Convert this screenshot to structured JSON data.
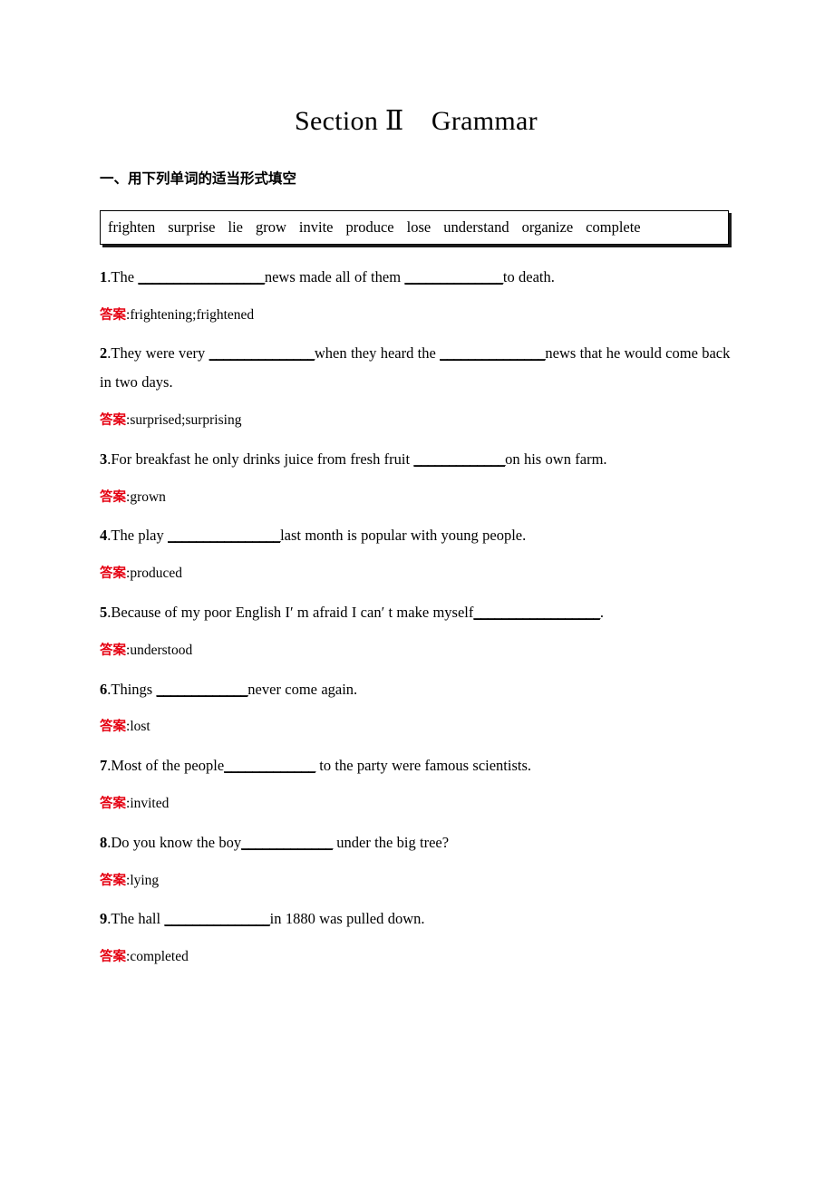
{
  "document": {
    "title": "Section Ⅱ　Grammar",
    "section_heading": "一、用下列单词的适当形式填空",
    "answer_label": "答案",
    "answer_separator": ":",
    "accent_color_answer_label": "#e50112",
    "text_color": "#000000",
    "background_color": "#ffffff"
  },
  "word_bank": {
    "words": [
      "frighten",
      "surprise",
      "lie",
      "grow",
      "invite",
      "produce",
      "lose",
      "understand",
      "organize",
      "complete"
    ]
  },
  "questions": [
    {
      "number": "1",
      "parts": [
        {
          "type": "text",
          "value": ".The "
        },
        {
          "type": "blank",
          "value": "__________________"
        },
        {
          "type": "text",
          "value": "news made all of them "
        },
        {
          "type": "blank",
          "value": "______________"
        },
        {
          "type": "text",
          "value": "to death."
        }
      ],
      "answer": "frightening;frightened"
    },
    {
      "number": "2",
      "parts": [
        {
          "type": "text",
          "value": ".They were very "
        },
        {
          "type": "blank",
          "value": "_______________"
        },
        {
          "type": "text",
          "value": "when they heard the "
        },
        {
          "type": "blank",
          "value": "_______________"
        },
        {
          "type": "text",
          "value": "news that he would come back in two days."
        }
      ],
      "answer": "surprised;surprising"
    },
    {
      "number": "3",
      "parts": [
        {
          "type": "text",
          "value": ".For breakfast he only drinks juice from fresh fruit "
        },
        {
          "type": "blank",
          "value": "_____________"
        },
        {
          "type": "text",
          "value": "on his own farm."
        }
      ],
      "answer": "grown"
    },
    {
      "number": "4",
      "parts": [
        {
          "type": "text",
          "value": ".The play "
        },
        {
          "type": "blank",
          "value": "________________"
        },
        {
          "type": "text",
          "value": "last month is popular with young people."
        }
      ],
      "answer": "produced"
    },
    {
      "number": "5",
      "parts": [
        {
          "type": "text",
          "value": ".Because of my poor English I′ m afraid I can′ t make myself"
        },
        {
          "type": "blank",
          "value": "__________________"
        },
        {
          "type": "text",
          "value": "."
        }
      ],
      "answer": "understood"
    },
    {
      "number": "6",
      "parts": [
        {
          "type": "text",
          "value": ".Things "
        },
        {
          "type": "blank",
          "value": "_____________"
        },
        {
          "type": "text",
          "value": "never come again."
        }
      ],
      "answer": "lost"
    },
    {
      "number": "7",
      "parts": [
        {
          "type": "text",
          "value": ".Most of the people"
        },
        {
          "type": "blank",
          "value": "_____________"
        },
        {
          "type": "text",
          "value": " to the party were famous scientists."
        }
      ],
      "answer": "invited"
    },
    {
      "number": "8",
      "parts": [
        {
          "type": "text",
          "value": ".Do you know the boy"
        },
        {
          "type": "blank",
          "value": "_____________"
        },
        {
          "type": "text",
          "value": " under the big tree?"
        }
      ],
      "answer": "lying"
    },
    {
      "number": "9",
      "parts": [
        {
          "type": "text",
          "value": ".The hall "
        },
        {
          "type": "blank",
          "value": "_______________"
        },
        {
          "type": "text",
          "value": "in 1880 was pulled down."
        }
      ],
      "answer": "completed"
    }
  ]
}
